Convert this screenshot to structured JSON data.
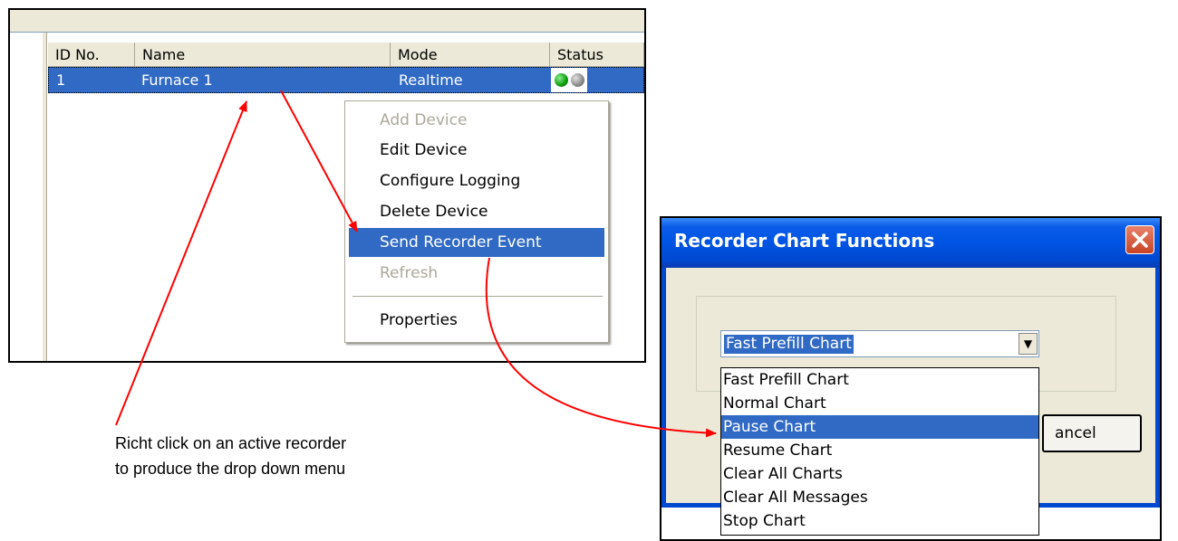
{
  "device_list": {
    "columns": [
      "ID No.",
      "Name",
      "Mode",
      "Status"
    ],
    "rows": [
      {
        "id": "1",
        "name": "Furnace 1",
        "mode": "Realtime",
        "status": [
          "green-led",
          "grey-led"
        ]
      }
    ]
  },
  "context_menu": {
    "items": [
      {
        "label": "Add Device",
        "enabled": false
      },
      {
        "label": "Edit Device",
        "enabled": true
      },
      {
        "label": "Configure Logging",
        "enabled": true
      },
      {
        "label": "Delete Device",
        "enabled": true
      },
      {
        "label": "Send Recorder Event",
        "enabled": true,
        "highlighted": true
      },
      {
        "label": "Refresh",
        "enabled": false
      },
      {
        "label": "Properties",
        "enabled": true
      }
    ]
  },
  "dialog": {
    "title": "Recorder Chart Functions",
    "selected_value": "Fast Prefill Chart",
    "options": [
      "Fast Prefill Chart",
      "Normal Chart",
      "Pause Chart",
      "Resume Chart",
      "Clear All Charts",
      "Clear All Messages",
      "Stop Chart"
    ],
    "highlighted_option": "Pause Chart",
    "cancel_label": "ancel"
  },
  "caption": {
    "line1": "Richt click on an active recorder",
    "line2": "to produce the drop down menu"
  },
  "colors": {
    "selection": "#316ac5",
    "arrow": "#ff0000",
    "xp_titlebar": "#0054e3",
    "dialog_face": "#ece9d8"
  },
  "icons": {
    "close": "close-icon",
    "dropdown": "chevron-down-icon",
    "status_on": "green-led-icon",
    "status_off": "grey-led-icon"
  }
}
